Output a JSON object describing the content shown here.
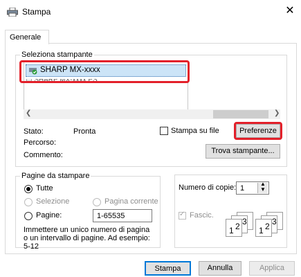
{
  "window": {
    "title": "Stampa",
    "close_symbol": "✕"
  },
  "tabs": [
    {
      "label": "Generale"
    }
  ],
  "printer_group": {
    "legend": "Seleziona stampante",
    "selected_printer": "SHARP MX-xxxx",
    "second_printer_partial": "▭ SHARP MX-xxxx PS"
  },
  "status": {
    "stato_label": "Stato:",
    "stato_value": "Pronta",
    "percorso_label": "Percorso:",
    "commento_label": "Commento:",
    "print_to_file_label": "Stampa su file",
    "preferences_button": "Preferenze",
    "find_printer_button": "Trova stampante..."
  },
  "page_range": {
    "legend": "Pagine da stampare",
    "all_label": "Tutte",
    "selection_label": "Selezione",
    "current_page_label": "Pagina corrente",
    "pages_label": "Pagine:",
    "pages_value": "1-65535",
    "hint": "Immettere un unico numero di pagina o un intervallo di pagine. Ad esempio: 5-12"
  },
  "copies": {
    "label": "Numero di copie:",
    "value": "1",
    "collate_label": "Fascic.",
    "collate_digits": [
      "1",
      "2",
      "3"
    ]
  },
  "footer": {
    "print_button": "Stampa",
    "cancel_button": "Annulla",
    "apply_button": "Applica"
  },
  "colors": {
    "highlight": "#e3202a",
    "selection": "#cce4f7"
  }
}
